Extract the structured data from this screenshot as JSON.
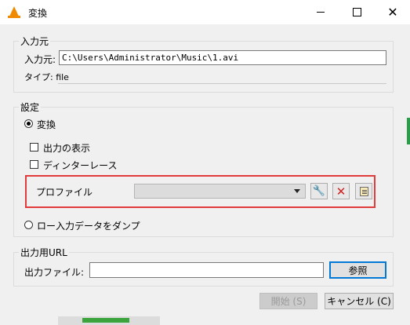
{
  "window": {
    "title": "変換",
    "controls": {
      "minimize": "minimize",
      "maximize": "maximize",
      "close": "✕"
    }
  },
  "source": {
    "legend": "入力元",
    "input_label": "入力元:",
    "input_value": "C:\\Users\\Administrator\\Music\\1.avi",
    "type_label": "タイプ: file"
  },
  "settings": {
    "legend": "設定",
    "convert_label": "変換",
    "convert_checked": true,
    "show_output_label": "出力の表示",
    "show_output_checked": false,
    "deinterlace_label": "ディンターレース",
    "deinterlace_checked": false,
    "profile_label": "プロファイル",
    "profile_value": "",
    "dump_label": "ロー入力データをダンプ",
    "dump_checked": false
  },
  "output": {
    "legend": "出力用URL",
    "file_label": "出力ファイル:",
    "file_value": "",
    "browse_button": "参照"
  },
  "footer": {
    "start_button": "開始 (S)",
    "cancel_button": "キャンセル (C)"
  },
  "colors": {
    "highlight": "#e23b3b",
    "vlc_orange": "#f08a00",
    "primary_border": "#0078d7"
  }
}
